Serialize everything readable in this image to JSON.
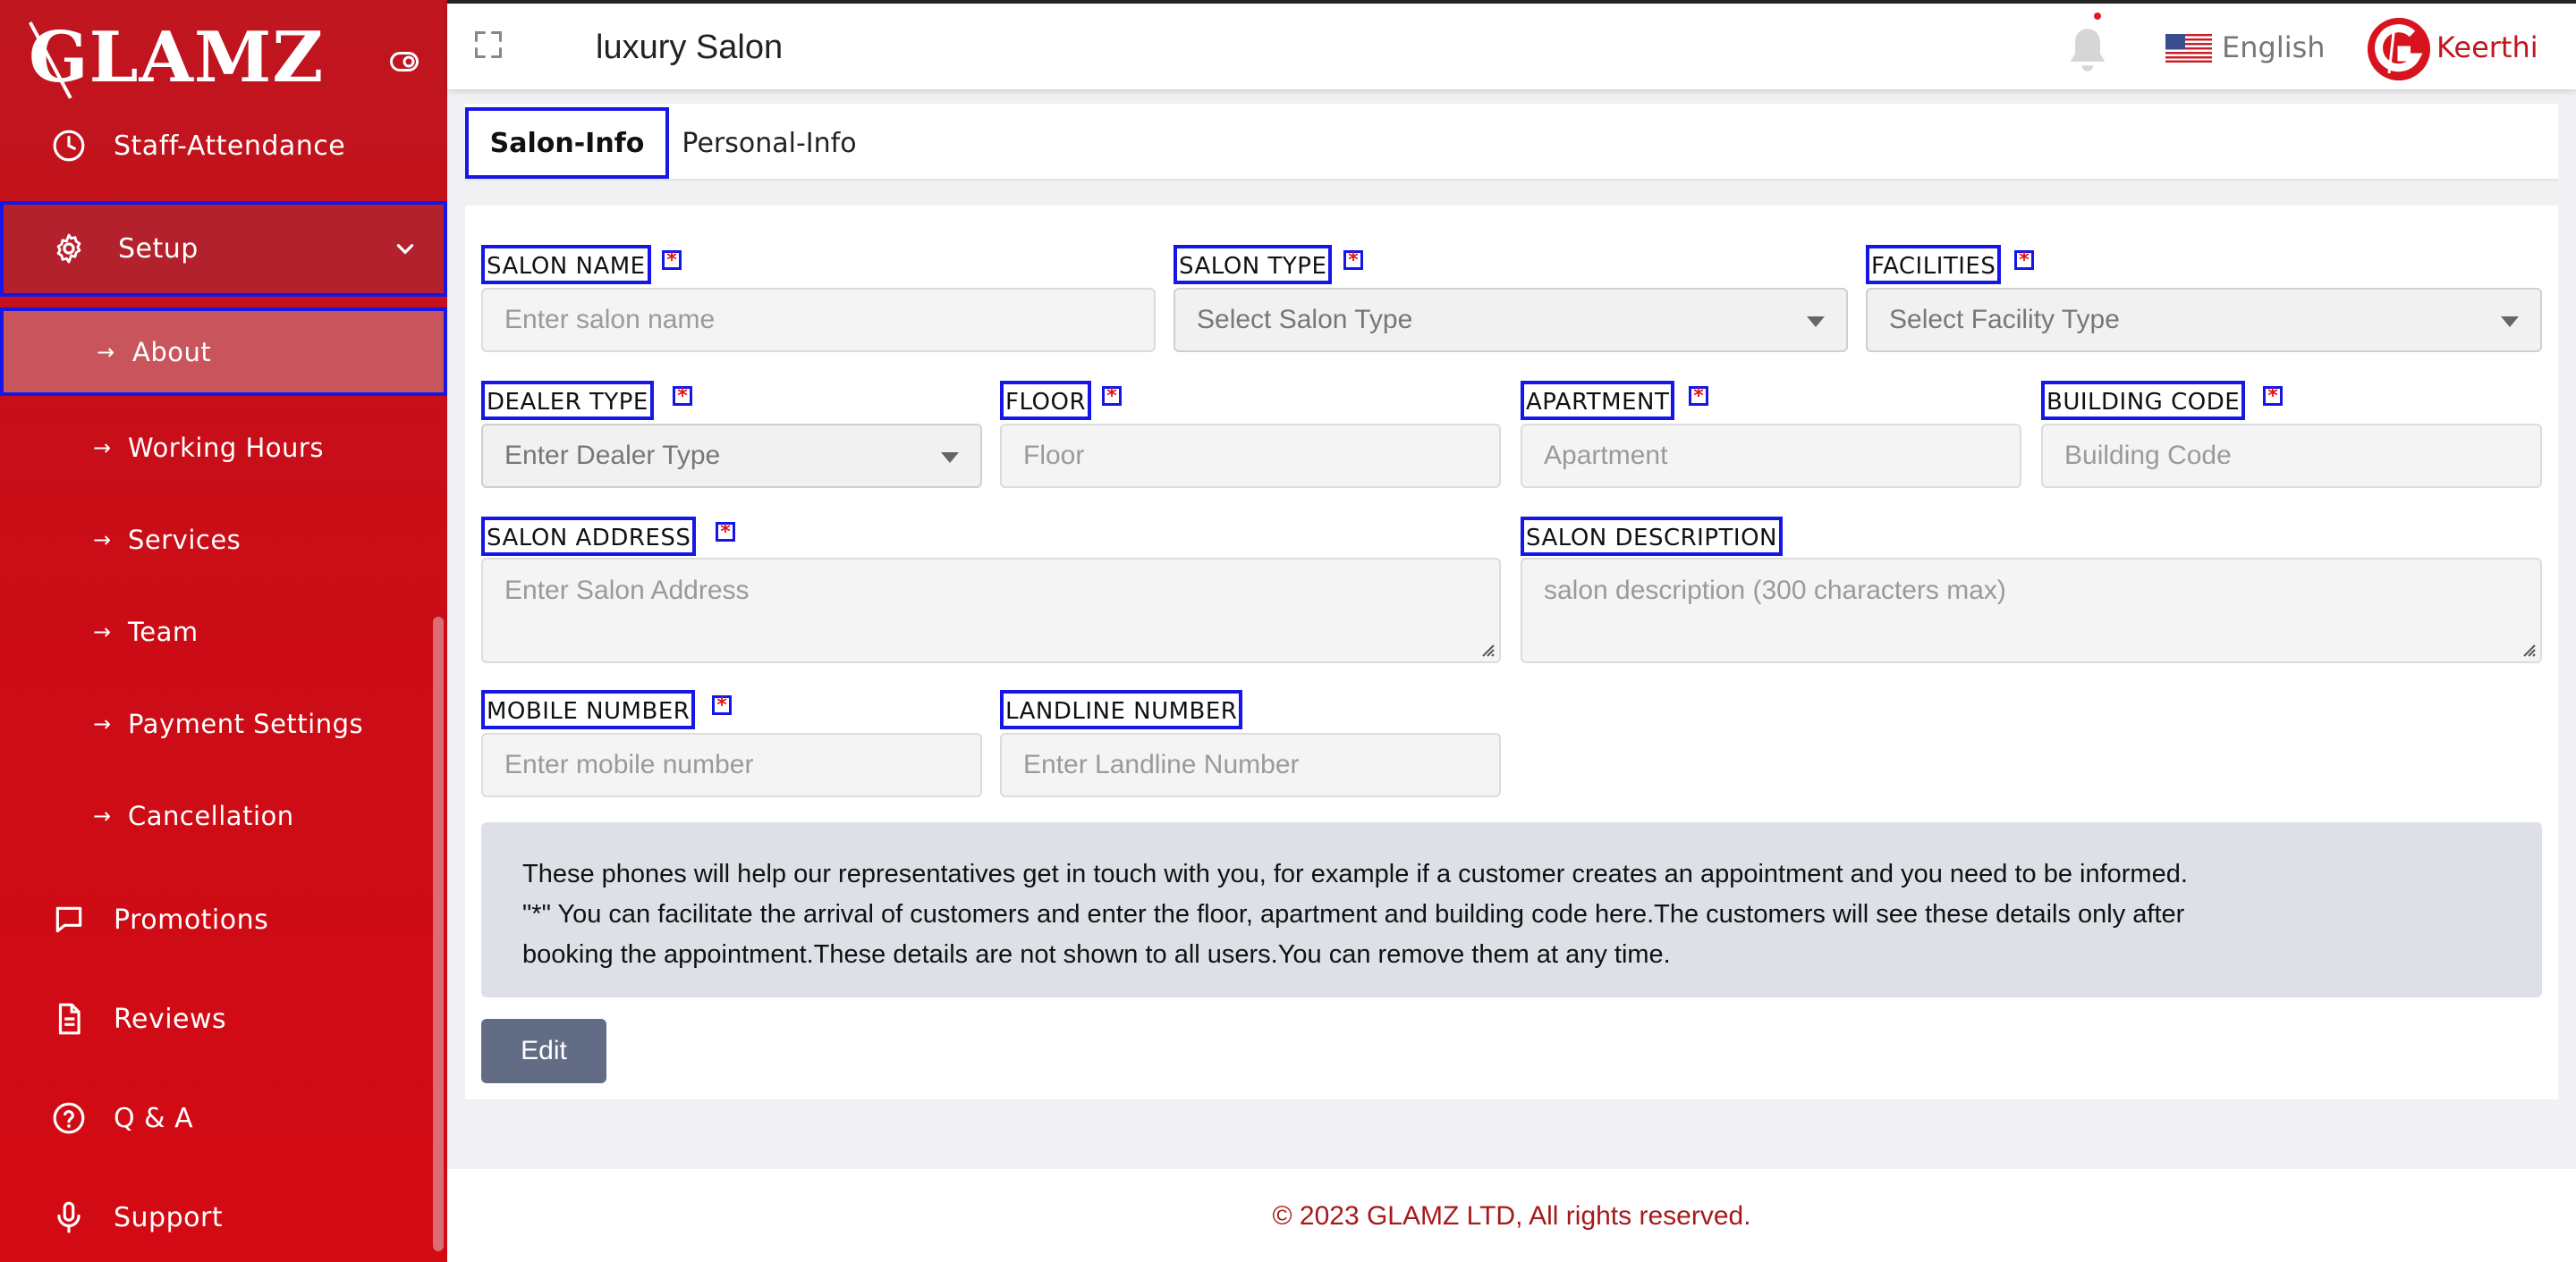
{
  "app": {
    "logo_text": "GLAMZ",
    "page_title": "luxury Salon"
  },
  "header": {
    "language": "English",
    "user_name": "Keerthi",
    "user_avatar_letter": "G"
  },
  "sidebar": {
    "items": [
      {
        "label": "Staff-Attendance",
        "icon": "clock-icon"
      },
      {
        "label": "Setup",
        "icon": "gear-icon",
        "expanded": true
      },
      {
        "label": "Promotions",
        "icon": "chat-icon"
      },
      {
        "label": "Reviews",
        "icon": "document-icon"
      },
      {
        "label": "Q & A",
        "icon": "question-icon"
      },
      {
        "label": "Support",
        "icon": "microphone-icon"
      }
    ],
    "setup_subitems": [
      {
        "label": "About",
        "active": true
      },
      {
        "label": "Working Hours"
      },
      {
        "label": "Services"
      },
      {
        "label": "Team"
      },
      {
        "label": "Payment Settings"
      },
      {
        "label": "Cancellation"
      }
    ]
  },
  "tabs": [
    {
      "label": "Salon-Info",
      "active": true
    },
    {
      "label": "Personal-Info",
      "active": false
    }
  ],
  "form": {
    "required_mark": "*",
    "salon_name": {
      "label": "SALON NAME",
      "placeholder": "Enter salon name"
    },
    "salon_type": {
      "label": "SALON TYPE",
      "placeholder": "Select Salon Type"
    },
    "facilities": {
      "label": "FACILITIES",
      "placeholder": "Select Facility Type"
    },
    "dealer_type": {
      "label": "DEALER TYPE",
      "placeholder": "Enter Dealer Type"
    },
    "floor": {
      "label": "FLOOR",
      "placeholder": "Floor"
    },
    "apartment": {
      "label": "APARTMENT",
      "placeholder": "Apartment"
    },
    "building_code": {
      "label": "BUILDING CODE",
      "placeholder": "Building Code"
    },
    "salon_address": {
      "label": "SALON ADDRESS",
      "placeholder": "Enter Salon Address"
    },
    "salon_description": {
      "label": "SALON DESCRIPTION",
      "placeholder": "salon description (300 characters max)"
    },
    "mobile_number": {
      "label": "MOBILE NUMBER",
      "placeholder": "Enter mobile number"
    },
    "landline_number": {
      "label": "LANDLINE NUMBER",
      "placeholder": "Enter Landline Number"
    }
  },
  "info": {
    "line1": "These phones will help our representatives get in touch with you, for example if a customer creates an appointment and you need to be informed.",
    "line2": "\"*\" You can facilitate the arrival of customers and enter the floor, apartment and building code here.The customers will see these details only after",
    "line3": "booking the appointment.These details are not shown to all users.You can remove them at any time."
  },
  "actions": {
    "edit_label": "Edit"
  },
  "footer": {
    "copyright": "© 2023 GLAMZ LTD, All rights reserved."
  },
  "colors": {
    "sidebar_red": "#c90d17",
    "active_sub_bg": "#c9555c",
    "highlight_outline": "#1616e8",
    "required_red": "#e0161e",
    "edit_button": "#626d85",
    "footer_text": "#a51a1a"
  }
}
